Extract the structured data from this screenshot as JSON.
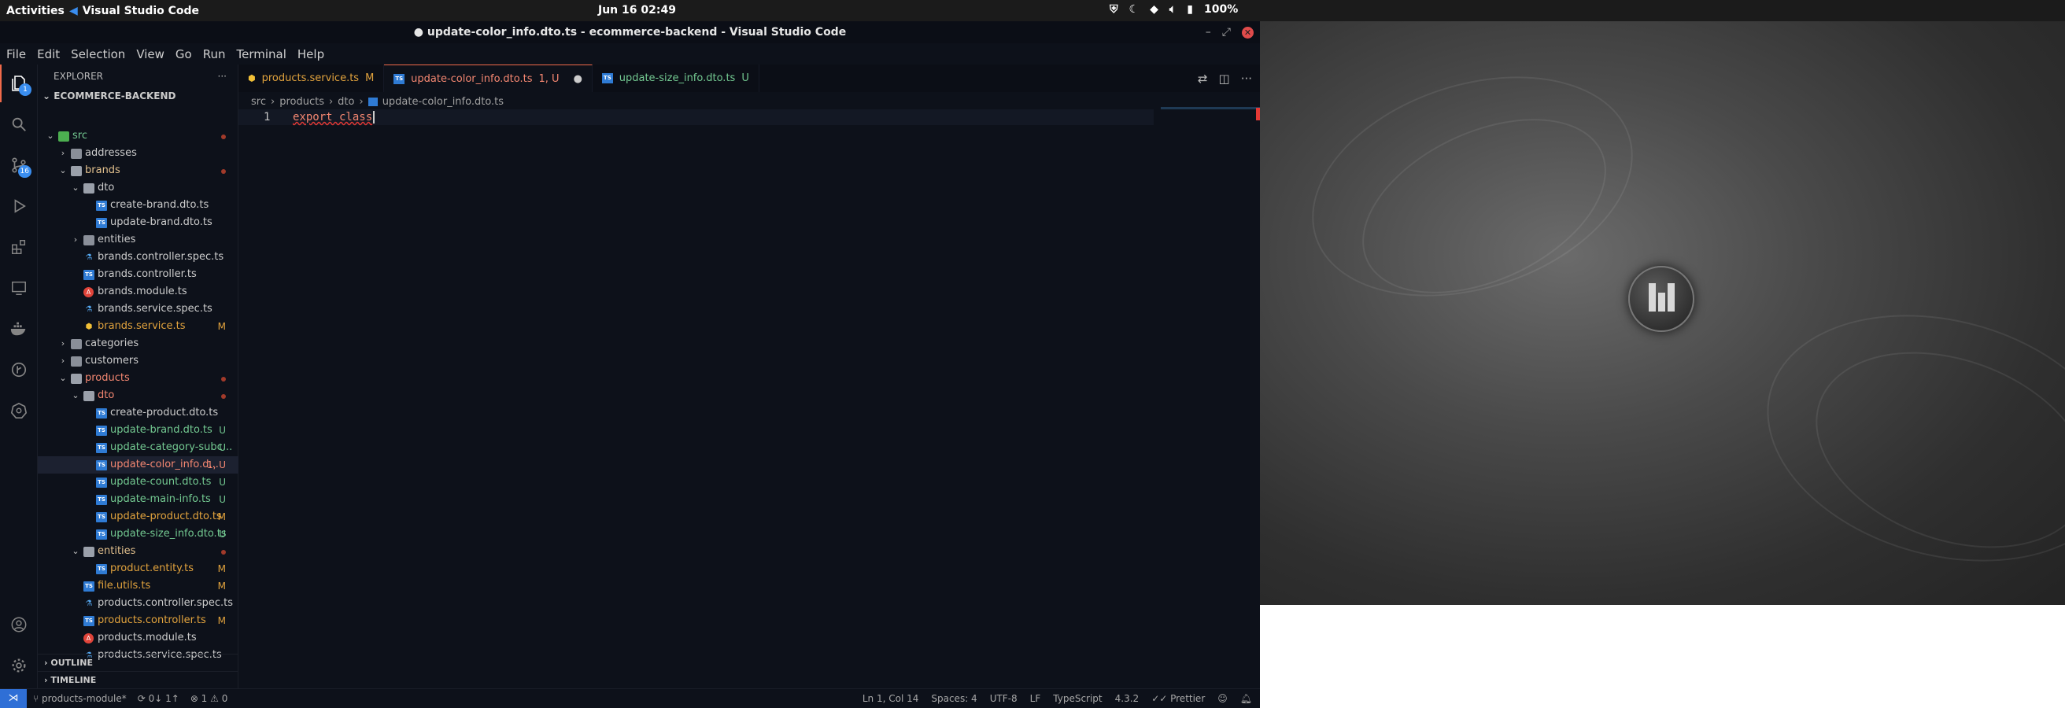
{
  "topbar": {
    "activities": "Activities",
    "app_name": "Visual Studio Code",
    "clock": "Jun 16  02:49",
    "battery": "100%"
  },
  "window": {
    "title": "● update-color_info.dto.ts - ecommerce-backend - Visual Studio Code"
  },
  "menu": [
    "File",
    "Edit",
    "Selection",
    "View",
    "Go",
    "Run",
    "Terminal",
    "Help"
  ],
  "activity_bar": {
    "explorer_badge": "1",
    "scm_badge": "16"
  },
  "explorer": {
    "header": "EXPLORER",
    "root": "ECOMMERCE-BACKEND",
    "tree": [
      {
        "label": "src",
        "type": "src",
        "depth": 0,
        "open": true,
        "color": "green",
        "status": "dot"
      },
      {
        "label": "addresses",
        "type": "folder",
        "depth": 1,
        "open": false,
        "color": "white",
        "status": ""
      },
      {
        "label": "brands",
        "type": "folder",
        "depth": 1,
        "open": true,
        "color": "orange",
        "status": "dot"
      },
      {
        "label": "dto",
        "type": "folder",
        "depth": 2,
        "open": true,
        "color": "white",
        "status": ""
      },
      {
        "label": "create-brand.dto.ts",
        "type": "ts",
        "depth": 3,
        "color": "white",
        "status": ""
      },
      {
        "label": "update-brand.dto.ts",
        "type": "ts",
        "depth": 3,
        "color": "white",
        "status": ""
      },
      {
        "label": "entities",
        "type": "folder",
        "depth": 2,
        "open": false,
        "color": "white",
        "status": ""
      },
      {
        "label": "brands.controller.spec.ts",
        "type": "spec",
        "depth": 2,
        "color": "white",
        "status": ""
      },
      {
        "label": "brands.controller.ts",
        "type": "ts",
        "depth": 2,
        "color": "white",
        "status": ""
      },
      {
        "label": "brands.module.ts",
        "type": "module",
        "depth": 2,
        "color": "white",
        "status": ""
      },
      {
        "label": "brands.service.spec.ts",
        "type": "spec",
        "depth": 2,
        "color": "white",
        "status": ""
      },
      {
        "label": "brands.service.ts",
        "type": "service",
        "depth": 2,
        "color": "mod",
        "status": "M"
      },
      {
        "label": "categories",
        "type": "folder",
        "depth": 1,
        "open": false,
        "color": "white",
        "status": ""
      },
      {
        "label": "customers",
        "type": "folder",
        "depth": 1,
        "open": false,
        "color": "white",
        "status": ""
      },
      {
        "label": "products",
        "type": "folder",
        "depth": 1,
        "open": true,
        "color": "red",
        "status": "dot"
      },
      {
        "label": "dto",
        "type": "folder",
        "depth": 2,
        "open": true,
        "color": "red",
        "status": "dot"
      },
      {
        "label": "create-product.dto.ts",
        "type": "ts",
        "depth": 3,
        "color": "white",
        "status": ""
      },
      {
        "label": "update-brand.dto.ts",
        "type": "ts",
        "depth": 3,
        "color": "untr",
        "status": "U"
      },
      {
        "label": "update-category-subc...",
        "type": "ts",
        "depth": 3,
        "color": "untr",
        "status": "U"
      },
      {
        "label": "update-color_info.d...",
        "type": "ts",
        "depth": 3,
        "color": "red",
        "status": "1, U",
        "selected": true
      },
      {
        "label": "update-count.dto.ts",
        "type": "ts",
        "depth": 3,
        "color": "untr",
        "status": "U"
      },
      {
        "label": "update-main-info.ts",
        "type": "ts",
        "depth": 3,
        "color": "untr",
        "status": "U"
      },
      {
        "label": "update-product.dto.ts",
        "type": "ts",
        "depth": 3,
        "color": "mod",
        "status": "M"
      },
      {
        "label": "update-size_info.dto.ts",
        "type": "ts",
        "depth": 3,
        "color": "untr",
        "status": "U"
      },
      {
        "label": "entities",
        "type": "folder",
        "depth": 2,
        "open": true,
        "color": "orange",
        "status": "dot"
      },
      {
        "label": "product.entity.ts",
        "type": "ts",
        "depth": 3,
        "color": "mod",
        "status": "M"
      },
      {
        "label": "file.utils.ts",
        "type": "ts",
        "depth": 2,
        "color": "mod",
        "status": "M"
      },
      {
        "label": "products.controller.spec.ts",
        "type": "spec",
        "depth": 2,
        "color": "white",
        "status": ""
      },
      {
        "label": "products.controller.ts",
        "type": "ts",
        "depth": 2,
        "color": "mod",
        "status": "M"
      },
      {
        "label": "products.module.ts",
        "type": "module",
        "depth": 2,
        "color": "white",
        "status": ""
      },
      {
        "label": "products.service.spec.ts",
        "type": "spec",
        "depth": 2,
        "color": "white",
        "status": ""
      }
    ],
    "outline": "OUTLINE",
    "timeline": "TIMELINE"
  },
  "tabs": [
    {
      "label": "products.service.ts",
      "status": "M",
      "icon": "service",
      "active": false,
      "color": "mod"
    },
    {
      "label": "update-color_info.dto.ts",
      "status": "1, U",
      "icon": "ts",
      "active": true,
      "color": "red",
      "dirty": "●"
    },
    {
      "label": "update-size_info.dto.ts",
      "status": "U",
      "icon": "ts",
      "active": false,
      "color": "untr"
    }
  ],
  "breadcrumb": [
    "src",
    "products",
    "dto",
    "update-color_info.dto.ts"
  ],
  "editor": {
    "line_number": "1",
    "code_line": "export class"
  },
  "statusbar": {
    "branch": "products-module*",
    "sync": "0↓ 1↑",
    "problems": "⊗ 1 ⚠ 0",
    "position": "Ln 1, Col 14",
    "spaces": "Spaces: 4",
    "encoding": "UTF-8",
    "eol": "LF",
    "language": "TypeScript",
    "ts_version": "4.3.2",
    "formatter": "✓✓ Prettier"
  },
  "colors": {
    "accent": "#f06a4a",
    "modified": "#e2a33d",
    "untracked": "#73c991",
    "error": "#f48771",
    "remote": "#2f6fd6"
  }
}
